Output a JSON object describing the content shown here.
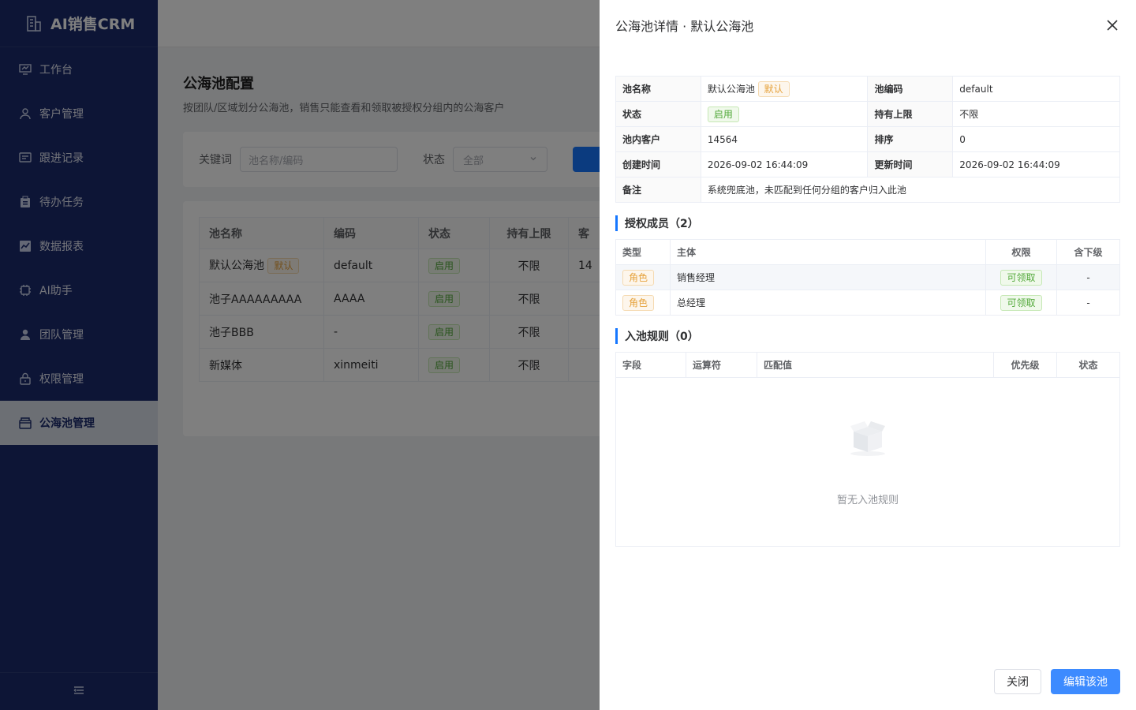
{
  "sidebar": {
    "brand": "AI销售CRM",
    "items": [
      {
        "label": "工作台",
        "icon": "dashboard-icon"
      },
      {
        "label": "客户管理",
        "icon": "user-icon"
      },
      {
        "label": "跟进记录",
        "icon": "message-icon"
      },
      {
        "label": "待办任务",
        "icon": "clipboard-icon"
      },
      {
        "label": "数据报表",
        "icon": "chart-icon"
      },
      {
        "label": "AI助手",
        "icon": "chip-icon"
      },
      {
        "label": "团队管理",
        "icon": "team-icon"
      },
      {
        "label": "权限管理",
        "icon": "lock-icon"
      },
      {
        "label": "公海池管理",
        "icon": "box-icon"
      }
    ],
    "active_index": 8,
    "colors": {
      "bg": "#1a2a6c",
      "active_bg": "#d9dee9"
    }
  },
  "page": {
    "title": "公海池配置",
    "subtitle": "按团队/区域划分公海池，销售只能查看和领取被授权分组内的公海客户",
    "filter": {
      "keyword_label": "关键词",
      "keyword_placeholder": "池名称/编码",
      "status_label": "状态",
      "status_value": "全部"
    },
    "table": {
      "headers": [
        "池名称",
        "编码",
        "状态",
        "持有上限",
        "客"
      ],
      "rows": [
        {
          "name": "默认公海池",
          "default_tag": "默认",
          "code": "default",
          "status": "启用",
          "limit": "不限",
          "extra": "14"
        },
        {
          "name": "池子AAAAAAAAA",
          "default_tag": "",
          "code": "AAAA",
          "status": "启用",
          "limit": "不限",
          "extra": ""
        },
        {
          "name": "池子BBB",
          "default_tag": "",
          "code": "-",
          "status": "启用",
          "limit": "不限",
          "extra": ""
        },
        {
          "name": "新媒体",
          "default_tag": "",
          "code": "xinmeiti",
          "status": "启用",
          "limit": "不限",
          "extra": ""
        }
      ]
    }
  },
  "drawer": {
    "title": "公海池详情 · 默认公海池",
    "info": {
      "name_label": "池名称",
      "name_value": "默认公海池",
      "default_tag": "默认",
      "code_label": "池编码",
      "code_value": "default",
      "status_label": "状态",
      "status_value": "启用",
      "limit_label": "持有上限",
      "limit_value": "不限",
      "customers_label": "池内客户",
      "customers_value": "14564",
      "sort_label": "排序",
      "sort_value": "0",
      "created_label": "创建时间",
      "created_value": "2026-09-02 16:44:09",
      "updated_label": "更新时间",
      "updated_value": "2026-09-02 16:44:09",
      "remark_label": "备注",
      "remark_value": "系统兜底池，未匹配到任何分组的客户归入此池"
    },
    "members": {
      "title": "授权成员（2）",
      "headers": [
        "类型",
        "主体",
        "权限",
        "含下级"
      ],
      "rows": [
        {
          "type": "角色",
          "subject": "销售经理",
          "permission": "可领取",
          "include_sub": "-"
        },
        {
          "type": "角色",
          "subject": "总经理",
          "permission": "可领取",
          "include_sub": "-"
        }
      ]
    },
    "rules": {
      "title": "入池规则（0）",
      "headers": [
        "字段",
        "运算符",
        "匹配值",
        "优先级",
        "状态"
      ],
      "empty_text": "暂无入池规则"
    },
    "footer": {
      "close_label": "关闭",
      "edit_label": "编辑该池"
    }
  }
}
